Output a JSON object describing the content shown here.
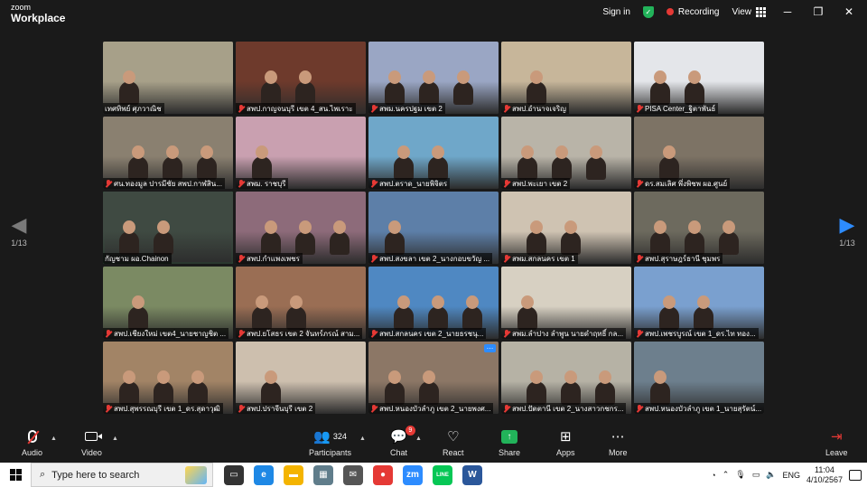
{
  "window": {
    "brand_small": "zoom",
    "brand_large": "Workplace",
    "sign_in": "Sign in",
    "recording": "Recording",
    "view": "View",
    "controls": [
      "─",
      "❐",
      "✕"
    ]
  },
  "gallery": {
    "page_indicator_left": "1/13",
    "page_indicator_right": "1/13",
    "tiles": [
      {
        "name": "เทศทิพย์ ศุภวาณิช",
        "bg": "#a7a089",
        "muted": false,
        "active": false
      },
      {
        "name": "สพป.กาญจนบุรี เขต 4_สน.ไพเราะ",
        "bg": "#6e3a2c",
        "muted": true,
        "active": false
      },
      {
        "name": "สพม.นครปฐม เขต 2",
        "bg": "#9aa6c4",
        "muted": true,
        "active": false
      },
      {
        "name": "สพป.อำนาจเจริญ",
        "bg": "#c7b69a",
        "muted": true,
        "active": false
      },
      {
        "name": "PISA Center_ฐิตาพันธ์",
        "bg": "#e4e6ea",
        "muted": true,
        "active": false
      },
      {
        "name": "ศน.ทองมูล ปารมีชัย สพป.กาฬสิน...",
        "bg": "#8a8070",
        "muted": true,
        "active": false
      },
      {
        "name": "สพม. ราชบุรี",
        "bg": "#c9a0b0",
        "muted": true,
        "active": false
      },
      {
        "name": "สพป.ตราด_นายพิจิตร",
        "bg": "#6fa7c9",
        "muted": true,
        "active": false
      },
      {
        "name": "สพป.พะเยา เขต 2",
        "bg": "#b9b4a8",
        "muted": true,
        "active": false
      },
      {
        "name": "ดร.สมเลิศ พึ่งพิชพ ผอ.ศูนย์",
        "bg": "#7d7365",
        "muted": true,
        "active": false
      },
      {
        "name": "กัญชาม ผอ.Chainon",
        "bg": "#3f4a42",
        "muted": false,
        "active": true
      },
      {
        "name": "สพป.กำแพงเพชร",
        "bg": "#8d6b7a",
        "muted": true,
        "active": false
      },
      {
        "name": "สพป.สงขลา เขต 2_นางกอบขวัญ ...",
        "bg": "#5d7fa8",
        "muted": true,
        "active": false
      },
      {
        "name": "สพม.สกลนคร เขต 1",
        "bg": "#cfc3b2",
        "muted": true,
        "active": false
      },
      {
        "name": "สพป.สุราษฎร์ธานี ชุมพร",
        "bg": "#6d6a5e",
        "muted": true,
        "active": false
      },
      {
        "name": "สพป.เชียงใหม่ เขต4_นายชาญชิต ...",
        "bg": "#7b8a63",
        "muted": true,
        "active": false
      },
      {
        "name": "สพป.ยโสธร เขต 2 จันทร์ภรณ์ สาม...",
        "bg": "#9a6e54",
        "muted": true,
        "active": false
      },
      {
        "name": "สพป.สกลนคร เขต 2_นายธรชนุ...",
        "bg": "#4f88c2",
        "muted": true,
        "active": false
      },
      {
        "name": "สพม.ลำปาง ลำพูน นายดำฤทธิ์ กล...",
        "bg": "#d7d0c2",
        "muted": true,
        "active": false
      },
      {
        "name": "สพป.เพชรบูรณ์ เขต 1_ดร.ไท ทอง...",
        "bg": "#7aa0cf",
        "muted": true,
        "active": false
      },
      {
        "name": "สพป.สุพรรณบุรี เขต 1_ดร.สุดาวุฒิ",
        "bg": "#a28466",
        "muted": true,
        "active": false
      },
      {
        "name": "สพป.ปราจีนบุรี เขต 2",
        "bg": "#cdbfae",
        "muted": true,
        "active": false
      },
      {
        "name": "สพป.หนองบัวลำภู เขต 2_นายพงศ...",
        "bg": "#8c7766",
        "muted": true,
        "active": false
      },
      {
        "name": "สพป.ปัตตานี เขต 2_นางสาวกชกร...",
        "bg": "#b6b2a5",
        "muted": true,
        "active": false
      },
      {
        "name": "สพป.หนองบัวลำภู เขต 1_นายสุรัตน์...",
        "bg": "#6d7f8d",
        "muted": true,
        "active": false
      }
    ]
  },
  "toolbar": {
    "audio": "Audio",
    "video": "Video",
    "participants": "Participants",
    "participants_count": "324",
    "chat": "Chat",
    "chat_badge": "9",
    "react": "React",
    "share": "Share",
    "apps": "Apps",
    "more": "More",
    "leave": "Leave"
  },
  "taskbar": {
    "search_placeholder": "Type here to search",
    "apps": [
      {
        "icon": "task-view-icon",
        "label": "▭",
        "color": "#333333"
      },
      {
        "icon": "edge-icon",
        "label": "e",
        "color": "#1e88e5"
      },
      {
        "icon": "file-explorer-icon",
        "label": "▬",
        "color": "#f4b400"
      },
      {
        "icon": "store-icon",
        "label": "▦",
        "color": "#607d8b"
      },
      {
        "icon": "mail-icon",
        "label": "✉",
        "color": "#555555"
      },
      {
        "icon": "chrome-icon",
        "label": "●",
        "color": "#e53935"
      },
      {
        "icon": "zoom-icon",
        "label": "zm",
        "color": "#2d8cff"
      },
      {
        "icon": "line-icon",
        "label": "LINE",
        "color": "#06c755"
      },
      {
        "icon": "word-icon",
        "label": "W",
        "color": "#2b579a"
      }
    ],
    "language": "ENG",
    "time": "11:04",
    "date": "4/10/2567"
  }
}
